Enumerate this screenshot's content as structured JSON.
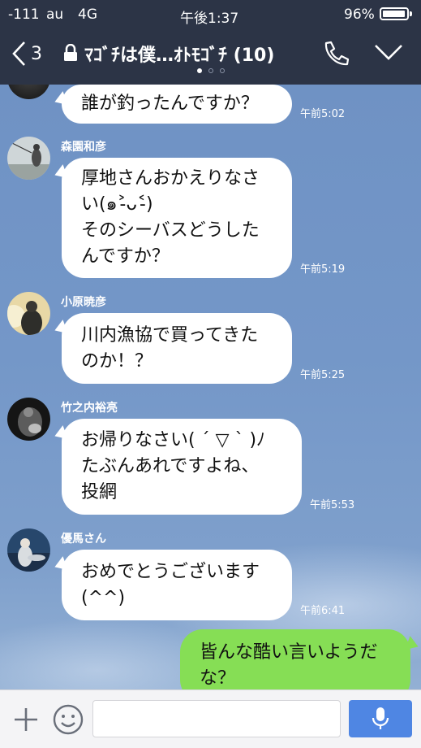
{
  "status_bar": {
    "signal": "-111",
    "carrier": "au",
    "network": "4G",
    "time": "午後1:37",
    "battery": "96%",
    "battery_level": 0.96
  },
  "header": {
    "back_count": "3",
    "title": "ﾏｺﾞﾁは僕…ｵﾄﾓｺﾞﾁ (10)",
    "icons": [
      "back-chevron-icon",
      "lock-icon",
      "phone-icon",
      "chevron-down-icon"
    ]
  },
  "messages": [
    {
      "sender": "",
      "lines": [
        "誰が釣ったんですか？"
      ],
      "time": "午前5:02"
    },
    {
      "sender": "森園和彦",
      "lines": [
        "厚地さんおかえりなさ",
        "い(๑˃̵ᴗ˂̵)",
        "そのシーバスどうした",
        "んですか？"
      ],
      "time": "午前5:19"
    },
    {
      "sender": "小原暁彦",
      "lines": [
        "川内漁協で買ってきた",
        "のか！？"
      ],
      "time": "午前5:25"
    },
    {
      "sender": "竹之内裕亮",
      "lines": [
        "お帰りなさい( ´ ▽ ` )ﾉ",
        "たぶんあれですよね、",
        "投網"
      ],
      "time": "午前5:53"
    },
    {
      "sender": "優馬さん",
      "lines": [
        "おめでとうございます",
        "(^^)"
      ],
      "time": "午前6:41"
    },
    {
      "sender": "me",
      "lines": [
        "皆んな酷い言いようだ",
        "な？"
      ],
      "time": ""
    }
  ],
  "input_bar": {
    "placeholder": "",
    "icons": [
      "plus-icon",
      "emoji-icon",
      "microphone-icon"
    ]
  },
  "colors": {
    "header_bg": "#2c3446",
    "chat_bg": "#7497c8",
    "my_bubble": "#86de55",
    "send_button": "#4f86e3"
  }
}
